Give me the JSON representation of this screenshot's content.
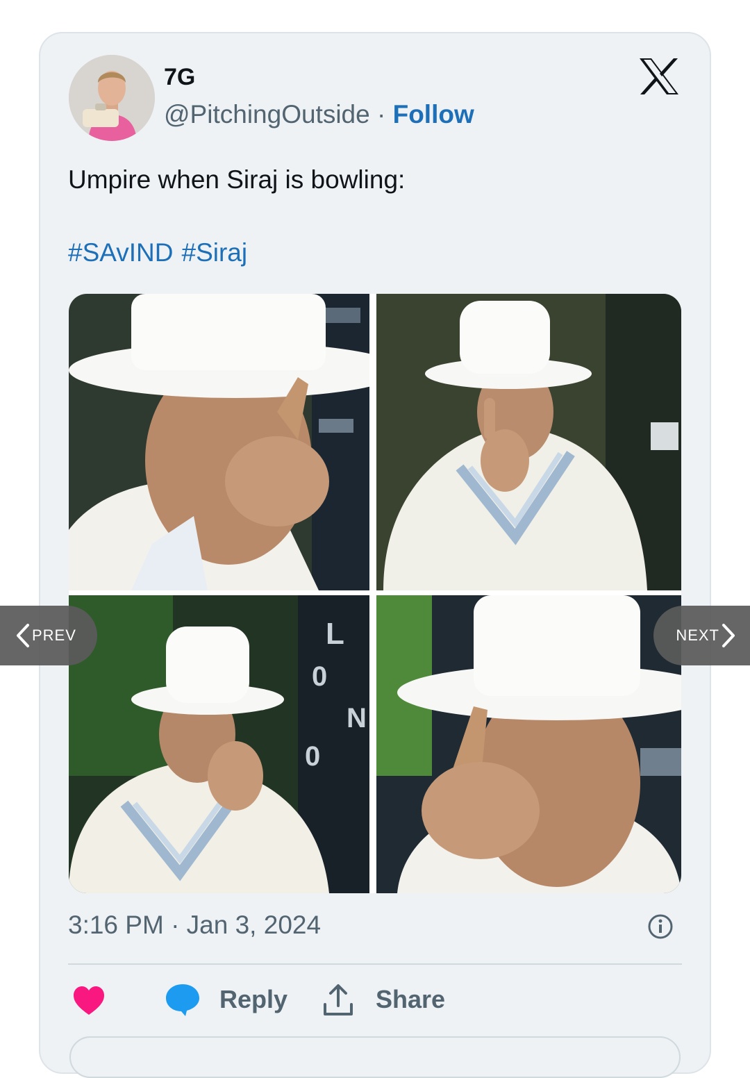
{
  "tweet": {
    "display_name": "7G",
    "handle": "@PitchingOutside",
    "separator": " · ",
    "follow_label": "Follow",
    "text": "Umpire when Siraj is bowling:",
    "hashtags": [
      "#SAvIND",
      "#Siraj"
    ],
    "timestamp": "3:16 PM · Jan 3, 2024"
  },
  "actions": {
    "like_icon": "heart-icon",
    "reply_label": "Reply",
    "share_label": "Share"
  },
  "gallery": {
    "prev_label": "PREV",
    "next_label": "NEXT",
    "image_count": 4
  },
  "colors": {
    "link_blue": "#1d6fb8",
    "secondary_text": "#536471",
    "heart": "#f91880",
    "reply_bubble": "#1d9bf0",
    "card_bg": "#eef2f5"
  }
}
